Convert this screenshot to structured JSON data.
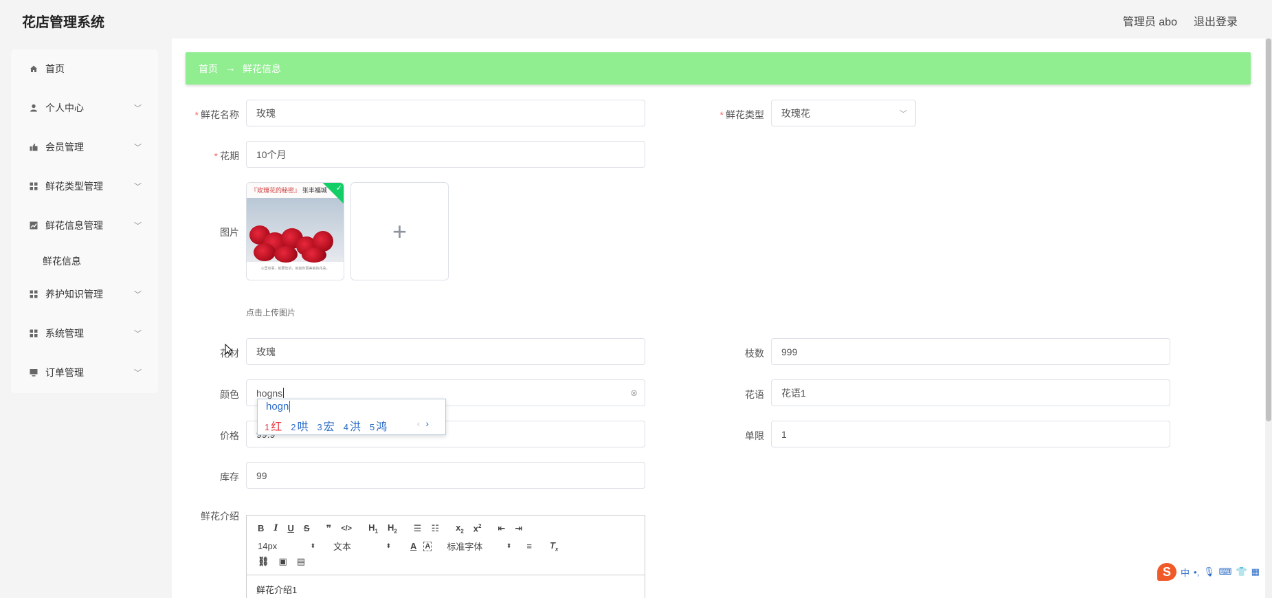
{
  "app": {
    "title": "花店管理系统",
    "user": "管理员 abo",
    "logout": "退出登录"
  },
  "sidebar": {
    "items": [
      {
        "label": "首页",
        "icon": "home-icon",
        "chevron": false
      },
      {
        "label": "个人中心",
        "icon": "user-icon",
        "chevron": true
      },
      {
        "label": "会员管理",
        "icon": "thumb-icon",
        "chevron": true
      },
      {
        "label": "鲜花类型管理",
        "icon": "grid-icon",
        "chevron": true
      },
      {
        "label": "鲜花信息管理",
        "icon": "chart-icon",
        "chevron": true
      },
      {
        "label": "养护知识管理",
        "icon": "grid-icon",
        "chevron": true
      },
      {
        "label": "系统管理",
        "icon": "grid-icon",
        "chevron": true
      },
      {
        "label": "订单管理",
        "icon": "monitor-icon",
        "chevron": true
      }
    ],
    "sub_item": "鲜花信息"
  },
  "breadcrumb": {
    "home": "首页",
    "arrow": "→",
    "current": "鲜花信息"
  },
  "form": {
    "name": {
      "label": "鲜花名称",
      "value": "玫瑰",
      "required": true
    },
    "type": {
      "label": "鲜花类型",
      "value": "玫瑰花",
      "required": true
    },
    "period": {
      "label": "花期",
      "value": "10个月",
      "required": true
    },
    "image": {
      "label": "图片",
      "tip": "点击上传图片",
      "plus": "+"
    },
    "material": {
      "label": "花材",
      "value": "玫瑰"
    },
    "count": {
      "label": "枝数",
      "value": "999"
    },
    "color": {
      "label": "颜色",
      "value": "hogns"
    },
    "language": {
      "label": "花语",
      "value": "花语1"
    },
    "price": {
      "label": "价格",
      "value": "99.9"
    },
    "limit": {
      "label": "单限",
      "value": "1"
    },
    "stock": {
      "label": "库存",
      "value": "99"
    },
    "intro": {
      "label": "鲜花介绍",
      "content": "鲜花介绍1"
    }
  },
  "thumb": {
    "header_left": "『玫瑰花的秘密』",
    "header_right": "张丰福城",
    "footer": "心里有事，就要告诉，就给你更美丽的花朵。"
  },
  "ime": {
    "input": "hogn",
    "candidates": [
      {
        "n": "1",
        "text": "红"
      },
      {
        "n": "2",
        "text": "哄"
      },
      {
        "n": "3",
        "text": "宏"
      },
      {
        "n": "4",
        "text": "洪"
      },
      {
        "n": "5",
        "text": "鸿"
      }
    ],
    "prev": "‹",
    "next": "›"
  },
  "editor": {
    "font_size": "14px",
    "text_style": "文本",
    "font_family": "标准字体"
  },
  "ime_bar": {
    "logo": "S",
    "lang": "中"
  }
}
